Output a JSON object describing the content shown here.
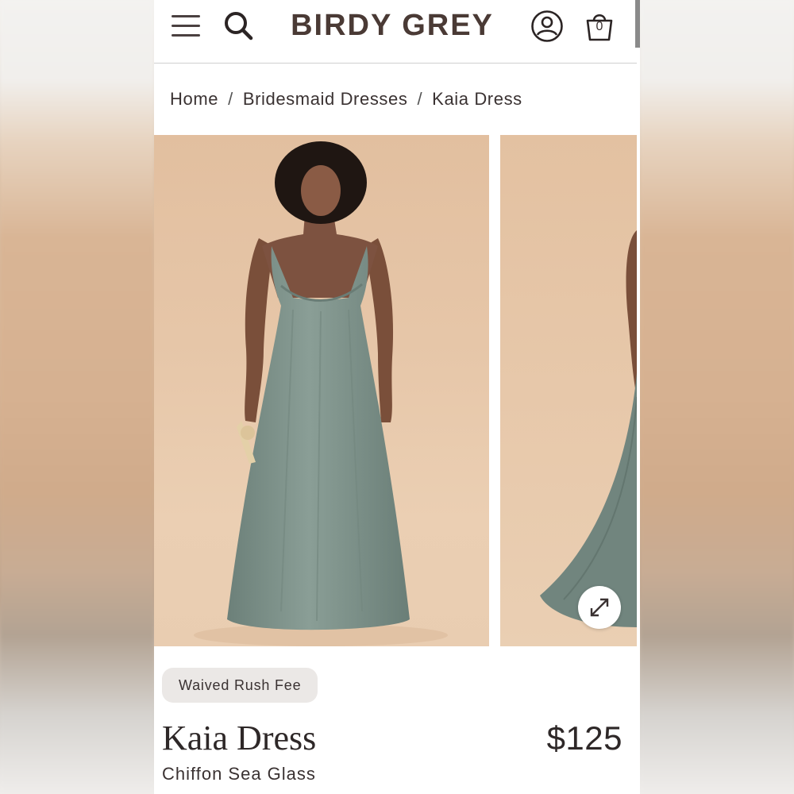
{
  "header": {
    "logo": "BIRDY GREY",
    "menu_icon": "hamburger-menu-icon",
    "search_icon": "search-icon",
    "account_icon": "account-icon",
    "bag_icon": "shopping-bag-icon",
    "bag_count": "0"
  },
  "breadcrumb": {
    "items": [
      "Home",
      "Bridesmaid Dresses",
      "Kaia Dress"
    ],
    "separator": "/"
  },
  "gallery": {
    "expand_icon": "expand-arrows-icon"
  },
  "product": {
    "badge": "Waived Rush Fee",
    "name": "Kaia Dress",
    "price": "$125",
    "color": "Chiffon Sea Glass"
  },
  "colors": {
    "logo": "#4a3a35",
    "dress": "#7d9189",
    "backdrop": "#e6c6a8",
    "badge_bg": "#ebe8e6"
  }
}
